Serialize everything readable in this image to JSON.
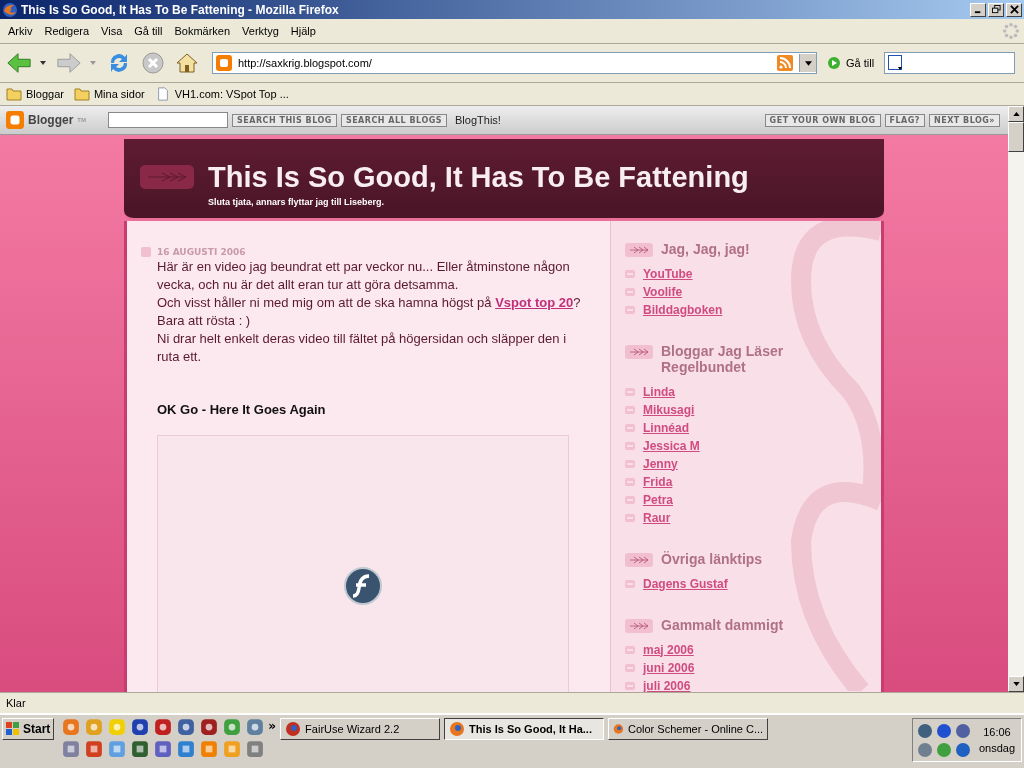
{
  "window": {
    "title": "This Is So Good, It Has To Be Fattening - Mozilla Firefox"
  },
  "menu": [
    "Arkiv",
    "Redigera",
    "Visa",
    "Gå till",
    "Bokmärken",
    "Verktyg",
    "Hjälp"
  ],
  "navigation": {
    "address": "http://saxkrig.blogspot.com/",
    "go_label": "Gå till"
  },
  "bookmarks": [
    {
      "label": "Bloggar",
      "kind": "folder"
    },
    {
      "label": "Mina sidor",
      "kind": "folder"
    },
    {
      "label": "VH1.com: VSpot Top ...",
      "kind": "page"
    }
  ],
  "blogger_bar": {
    "logo": "Blogger",
    "logo_mark": "TM",
    "left_buttons": [
      "SEARCH THIS BLOG",
      "SEARCH ALL BLOGS"
    ],
    "blogthis": "BlogThis!",
    "right_buttons": [
      "GET YOUR OWN BLOG",
      "FLAG?",
      "NEXT BLOG»"
    ]
  },
  "blog": {
    "title": "This Is So Good, It Has To Be Fattening",
    "subtitle": "Sluta tjata, annars flyttar jag till Liseberg.",
    "post": {
      "date": "16 AUGUSTI 2006",
      "lines": [
        {
          "text": "Här är en video jag beundrat ett par veckor nu... Eller åtminstone någon vecka, och nu är det allt eran tur att göra detsamma."
        },
        {
          "text": "Och visst håller ni med mig om att de ska hamna högst på ",
          "link": "Vspot top 20",
          "after": "?"
        },
        {
          "text": "Bara att rösta : )"
        },
        {
          "text": "Ni drar helt enkelt deras video till fältet på högersidan och släpper den i ruta ett."
        }
      ],
      "video_title": "OK Go - Here It Goes Again"
    },
    "sidebar": [
      {
        "heading": "Jag, Jag, jag!",
        "links": [
          "YouTube",
          "Voolife",
          "Bilddagboken"
        ]
      },
      {
        "heading": "Bloggar Jag Läser Regelbundet",
        "links": [
          "Linda",
          "Mikusagi",
          "Linnéad",
          "Jessica M",
          "Jenny",
          "Frida",
          "Petra",
          "Raur"
        ]
      },
      {
        "heading": "Övriga länktips",
        "links": [
          "Dagens Gustaf"
        ]
      },
      {
        "heading": "Gammalt dammigt",
        "links": [
          "maj 2006",
          "juni 2006",
          "juli 2006"
        ]
      }
    ]
  },
  "status_bar": "Klar",
  "taskbar": {
    "start": "Start",
    "more": "»",
    "tasks": [
      {
        "label": "FairUse Wizard 2.2",
        "selected": false
      },
      {
        "label": "This Is So Good, It Ha...",
        "selected": true
      },
      {
        "label": "Color Schemer - Online C...",
        "selected": false
      }
    ],
    "time": "16:06",
    "day": "onsdag"
  }
}
